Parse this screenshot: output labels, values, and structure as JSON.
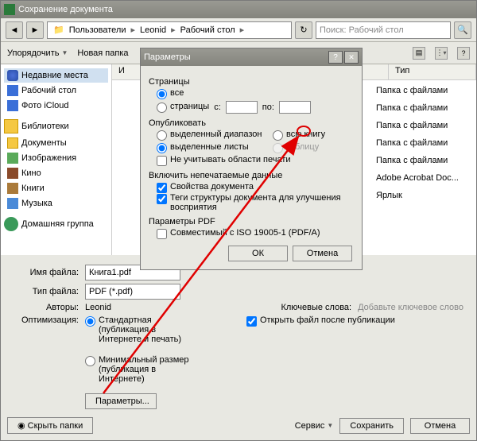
{
  "main": {
    "title": "Сохранение документа",
    "breadcrumb": [
      "Пользователи",
      "Leonid",
      "Рабочий стол"
    ],
    "search_placeholder": "Поиск: Рабочий стол",
    "toolbar": {
      "organize": "Упорядочить",
      "newfolder": "Новая папка"
    },
    "columns": {
      "name": "И",
      "type": "Тип"
    },
    "file_types": [
      "Папка с файлами",
      "Папка с файлами",
      "Папка с файлами",
      "Папка с файлами",
      "Папка с файлами",
      "Adobe Acrobat Doc...",
      "Ярлык"
    ]
  },
  "sidebar": {
    "items": [
      {
        "label": "Недавние места",
        "ico": "star"
      },
      {
        "label": "Рабочий стол",
        "ico": "blue"
      },
      {
        "label": "Фото iCloud",
        "ico": "blue"
      }
    ],
    "lib_header": "Библиотеки",
    "libs": [
      {
        "label": "Документы",
        "ico": "folder"
      },
      {
        "label": "Изображения",
        "ico": "pic"
      },
      {
        "label": "Кино",
        "ico": "film"
      },
      {
        "label": "Книги",
        "ico": "book"
      },
      {
        "label": "Музыка",
        "ico": "music"
      }
    ],
    "homegroup": "Домашняя группа"
  },
  "form": {
    "filename_label": "Имя файла:",
    "filename": "Книга1.pdf",
    "filetype_label": "Тип файла:",
    "filetype": "PDF (*.pdf)",
    "authors_label": "Авторы:",
    "authors": "Leonid",
    "keywords_label": "Ключевые слова:",
    "keywords_hint": "Добавьте ключевое слово",
    "optimization_label": "Оптимизация:",
    "opt_std": "Стандартная (публикация в Интернете и печать)",
    "opt_min": "Минимальный размер (публикация в Интернете)",
    "open_after": "Открыть файл после публикации",
    "params_btn": "Параметры..."
  },
  "footer": {
    "hide": "Скрыть папки",
    "service": "Сервис",
    "save": "Сохранить",
    "cancel": "Отмена"
  },
  "popup": {
    "title": "Параметры",
    "pages": "Страницы",
    "all": "все",
    "pages_range": "страницы",
    "from": "с:",
    "to": "по:",
    "publish": "Опубликовать",
    "sel_range": "выделенный диапазон",
    "sel_sheets": "выделенные листы",
    "whole_book": "всю книгу",
    "table": "таблицу",
    "ignore_print": "Не учитывать области печати",
    "include": "Включить непечатаемые данные",
    "doc_props": "Свойства документа",
    "struct_tags": "Теги структуры документа для улучшения восприятия",
    "pdf_params": "Параметры PDF",
    "iso": "Совместимый с ISO 19005-1 (PDF/A)",
    "ok": "ОК",
    "cancel": "Отмена"
  }
}
